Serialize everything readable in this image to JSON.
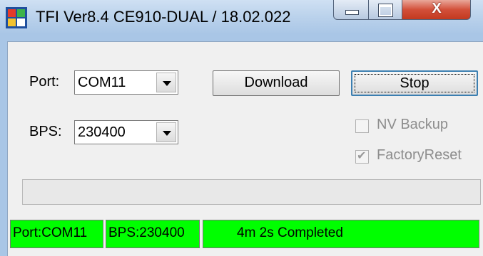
{
  "window": {
    "title": "TFI Ver8.4 CE910-DUAL / 18.02.022",
    "close_glyph": "X",
    "icon": "app-logo-icon"
  },
  "port": {
    "label": "Port:",
    "value": "COM11"
  },
  "bps": {
    "label": "BPS:",
    "value": "230400"
  },
  "buttons": {
    "download": "Download",
    "stop": "Stop"
  },
  "options": {
    "nv_backup": {
      "label": "NV Backup",
      "checked": false
    },
    "factory_reset": {
      "label": "FactoryReset",
      "checked": true
    }
  },
  "status_bar": {
    "port": "Port:COM11",
    "bps": "BPS:230400",
    "message": "4m  2s Completed"
  },
  "colors": {
    "status_bg": "#00ff00",
    "title_bar": "#bcd3ec"
  }
}
